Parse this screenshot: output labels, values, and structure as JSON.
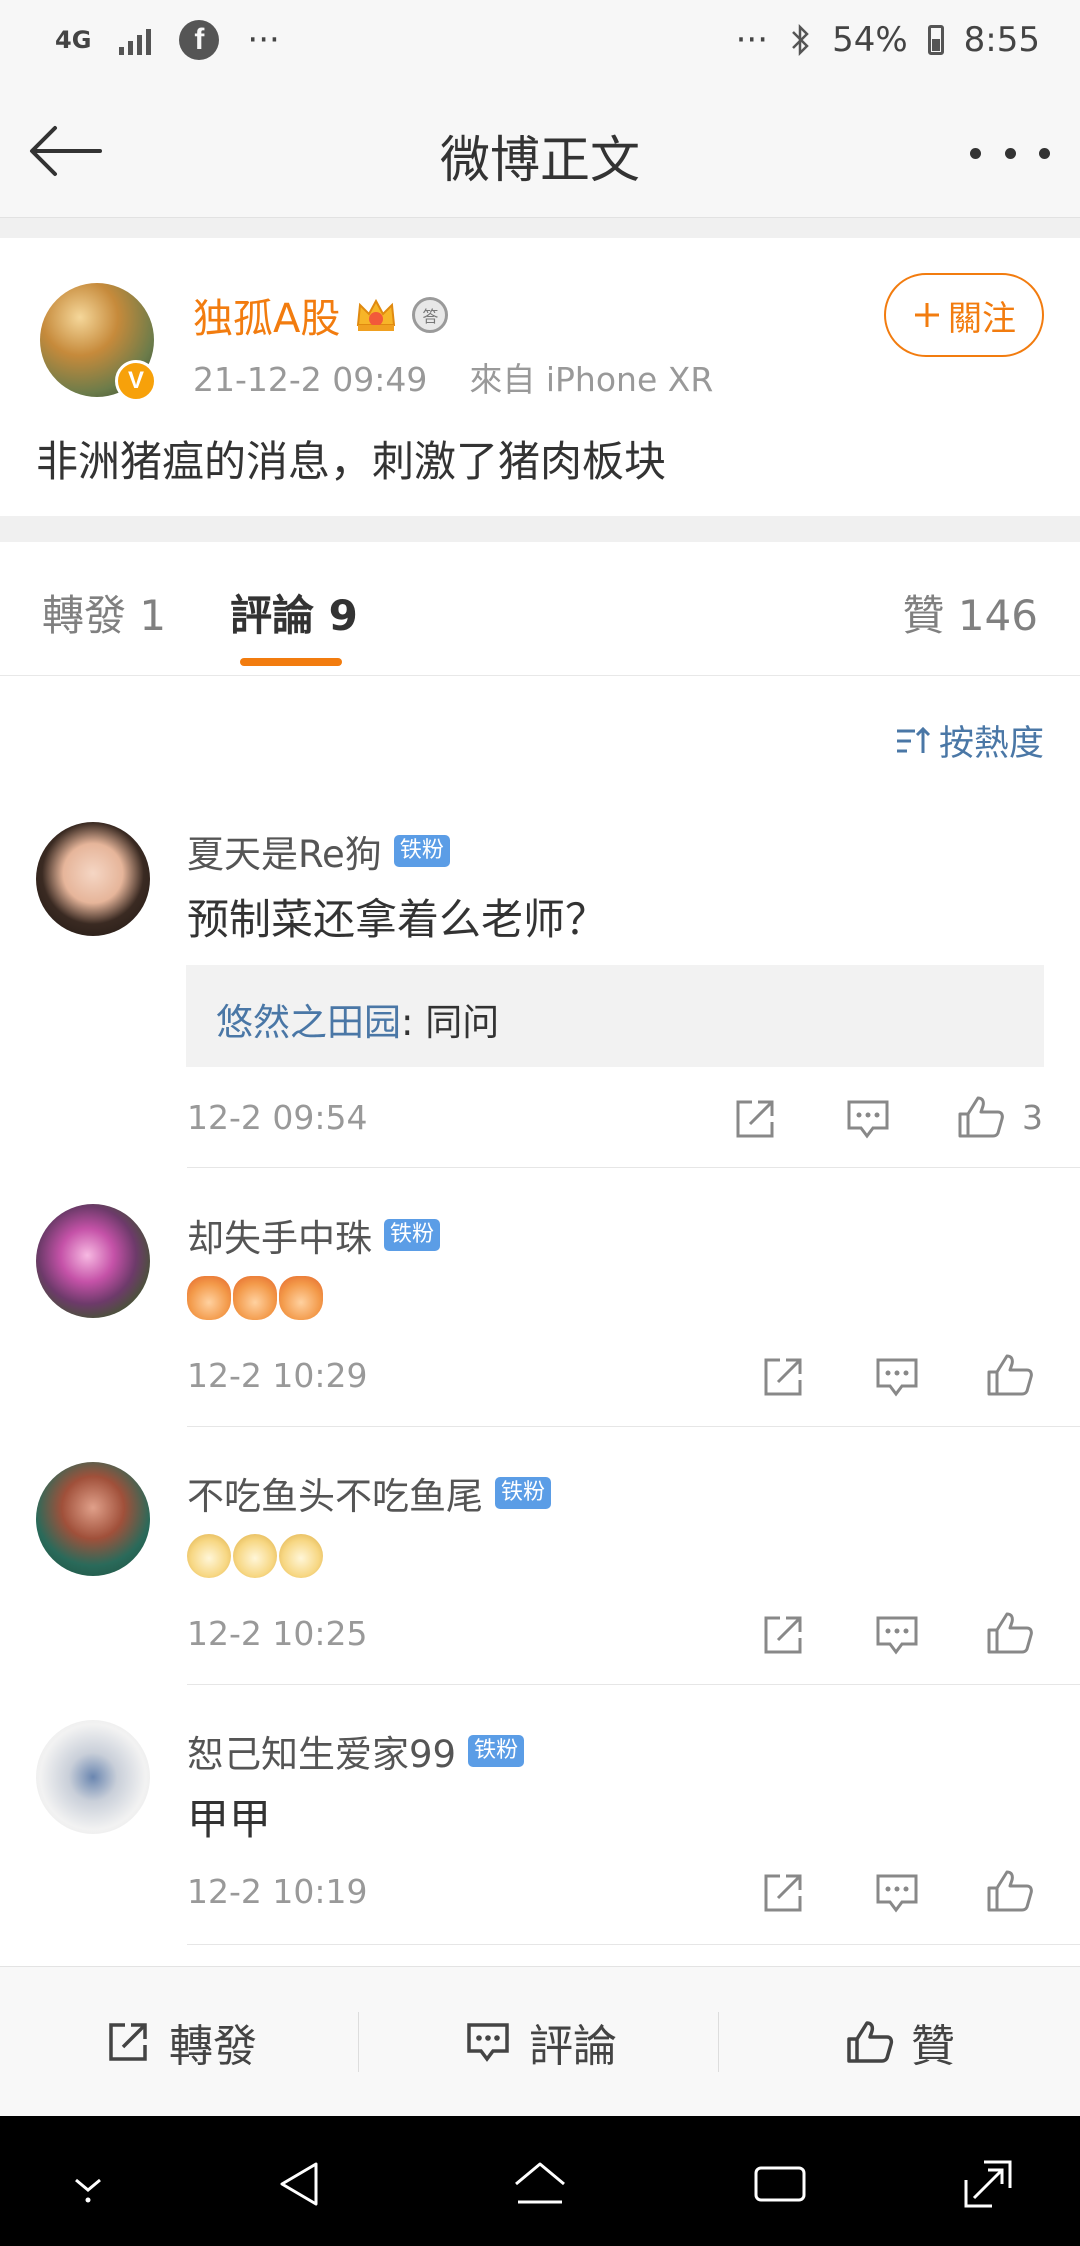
{
  "status_bar": {
    "network": "4G",
    "app_icon": "facebook-icon",
    "left_more": "···",
    "right_more": "···",
    "bluetooth_icon": "bluetooth-icon",
    "battery": "54%",
    "time": "8:55"
  },
  "nav": {
    "title": "微博正文",
    "back_icon": "back-arrow-icon",
    "more_icon": "more-dots-icon"
  },
  "post": {
    "author": "独孤A股",
    "verified_badge": "V",
    "medal_text": "答",
    "time": "21-12-2 09:49",
    "source": "來自 iPhone XR",
    "follow_label": "關注",
    "text": "非洲猪瘟的消息，刺激了猪肉板块"
  },
  "tabs": {
    "repost": "轉發 1",
    "comments": "評論 9",
    "likes": "贊 146"
  },
  "sort_label": "按熱度",
  "comments": [
    {
      "name": "夏天是Re狗",
      "badge": "铁粉",
      "text": "预制菜还拿着么老师？",
      "reply_name": "悠然之田园",
      "reply_sep": ":",
      "reply_text": " 同问",
      "time": "12-2 09:54",
      "like_count": "3"
    },
    {
      "name": "却失手中珠",
      "badge": "铁粉",
      "emoji": "clapping-hands",
      "time": "12-2 10:29"
    },
    {
      "name": "不吃鱼头不吃鱼尾",
      "badge": "铁粉",
      "emoji": "doge",
      "time": "12-2 10:25"
    },
    {
      "name": "恕己知生爱家99",
      "badge": "铁粉",
      "text": "甲甲",
      "time": "12-2 10:19"
    }
  ],
  "bottom_bar": {
    "repost": "轉發",
    "comment": "評論",
    "like": "贊"
  },
  "colors": {
    "accent": "#f27c0f",
    "link": "#4a77a6",
    "badge": "#5b9de6"
  }
}
